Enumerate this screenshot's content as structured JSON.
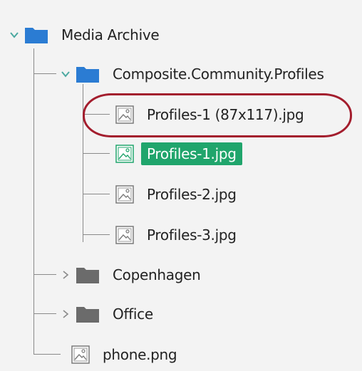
{
  "tree": {
    "root": {
      "label": "Media Archive",
      "icon": "folder-icon",
      "expanded": true
    },
    "children": [
      {
        "label": "Composite.Community.Profiles",
        "icon": "folder-icon",
        "expanded": true,
        "children": [
          {
            "label": "Profiles-1 (87x117).jpg",
            "icon": "image-icon",
            "highlighted": true
          },
          {
            "label": "Profiles-1.jpg",
            "icon": "image-icon",
            "selected": true
          },
          {
            "label": "Profiles-2.jpg",
            "icon": "image-icon"
          },
          {
            "label": "Profiles-3.jpg",
            "icon": "image-icon"
          }
        ]
      },
      {
        "label": "Copenhagen",
        "icon": "folder-icon",
        "expanded": false
      },
      {
        "label": "Office",
        "icon": "folder-icon",
        "expanded": false
      },
      {
        "label": "phone.png",
        "icon": "image-icon"
      }
    ]
  },
  "colors": {
    "folder_blue": "#2b7cd3",
    "folder_gray": "#6b6b6b",
    "selection_green": "#20a56c",
    "highlight_red": "#a31d2d",
    "chevron_teal": "#4aa8a0"
  }
}
